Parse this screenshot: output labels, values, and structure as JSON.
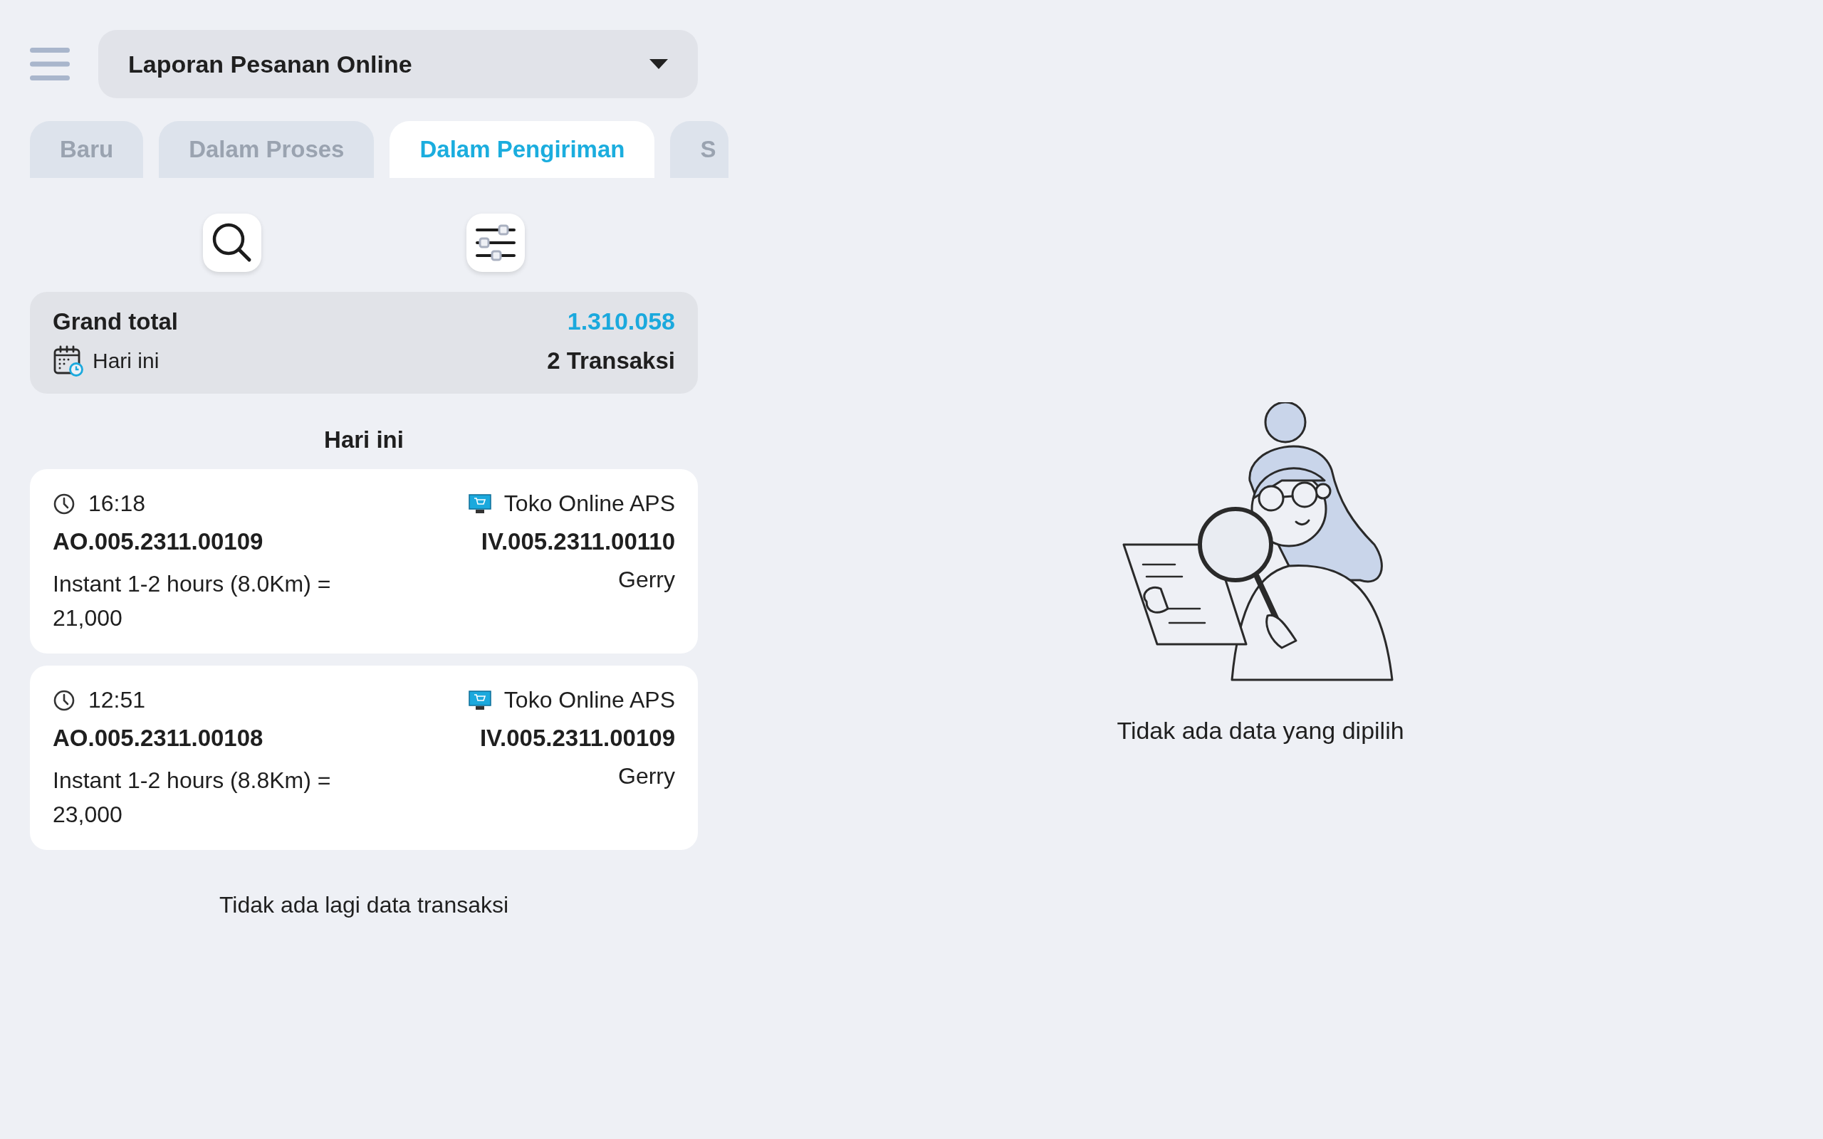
{
  "header": {
    "report_select": {
      "value": "Laporan Pesanan Online"
    }
  },
  "tabs": [
    {
      "label": "Baru",
      "selected": false
    },
    {
      "label": "Dalam Proses",
      "selected": false
    },
    {
      "label": "Dalam Pengiriman",
      "selected": true
    },
    {
      "label": "S",
      "selected": false
    }
  ],
  "summary": {
    "label": "Grand total",
    "amount": "1.310.058",
    "period": "Hari ini",
    "count": "2 Transaksi"
  },
  "group_heading": "Hari ini",
  "orders": [
    {
      "time": "16:18",
      "store": "Toko Online APS",
      "order_no": "AO.005.2311.00109",
      "invoice_no": "IV.005.2311.00110",
      "shipping": "Instant 1-2 hours (8.0Km) = 21,000",
      "courier": "Gerry"
    },
    {
      "time": "12:51",
      "store": "Toko Online APS",
      "order_no": "AO.005.2311.00108",
      "invoice_no": "IV.005.2311.00109",
      "shipping": "Instant 1-2 hours (8.8Km) = 23,000",
      "courier": "Gerry"
    }
  ],
  "list_end": "Tidak ada lagi data transaksi",
  "detail": {
    "empty_message": "Tidak ada data yang dipilih"
  }
}
